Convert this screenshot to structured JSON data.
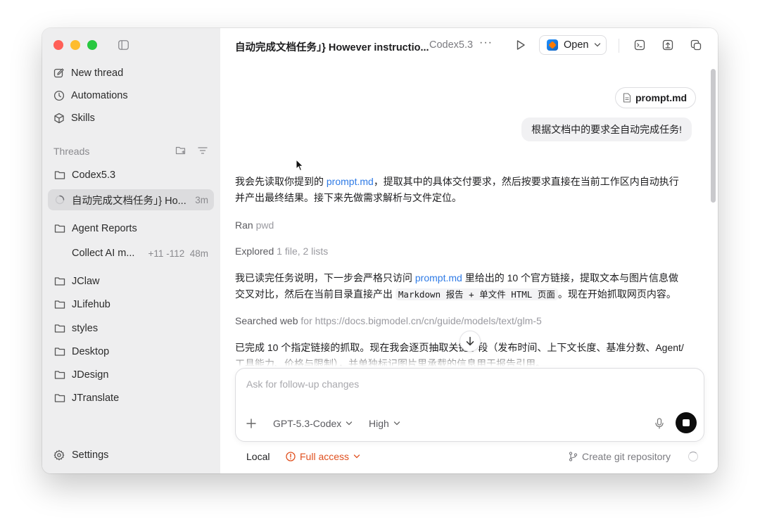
{
  "sidebar": {
    "nav": [
      {
        "label": "New thread",
        "icon": "compose-icon"
      },
      {
        "label": "Automations",
        "icon": "clock-icon"
      },
      {
        "label": "Skills",
        "icon": "cube-icon"
      }
    ],
    "threads_label": "Threads",
    "threads": [
      {
        "title": "Codex5.3",
        "meta": "",
        "type": "folder"
      },
      {
        "title": "自动完成文档任务」} Ho...",
        "meta": "3m",
        "type": "active"
      },
      {
        "title": "Agent Reports",
        "meta": "",
        "type": "folder"
      },
      {
        "title": "Collect AI m...",
        "meta_add": "+11",
        "meta_del": "-112",
        "meta": "48m",
        "type": "item"
      },
      {
        "title": "JClaw",
        "meta": "",
        "type": "folder"
      },
      {
        "title": "JLifehub",
        "meta": "",
        "type": "folder"
      },
      {
        "title": "styles",
        "meta": "",
        "type": "folder"
      },
      {
        "title": "Desktop",
        "meta": "",
        "type": "folder"
      },
      {
        "title": "JDesign",
        "meta": "",
        "type": "folder"
      },
      {
        "title": "JTranslate",
        "meta": "",
        "type": "folder"
      }
    ],
    "settings_label": "Settings"
  },
  "topbar": {
    "title": "自动完成文档任务」} However instructio...",
    "project": "Codex5.3",
    "more": "···",
    "open_label": "Open"
  },
  "conversation": {
    "attachment": "prompt.md",
    "user_message": "根据文档中的要求全自动完成任务!",
    "reply1_pre": "我会先读取你提到的 ",
    "reply1_link": "prompt.md",
    "reply1_post": "，提取其中的具体交付要求，然后按要求直接在当前工作区内自动执行并产出最终结果。接下来先做需求解析与文件定位。",
    "ran_label": "Ran",
    "ran_value": "pwd",
    "explored_label": "Explored",
    "explored_value": "1 file, 2 lists",
    "reply2_pre": "我已读完任务说明，下一步会严格只访问 ",
    "reply2_link": "prompt.md",
    "reply2_mid": " 里给出的 10 个官方链接，提取文本与图片信息做交叉对比，然后在当前目录直接产出 ",
    "reply2_code": "Markdown 报告 + 单文件 HTML 页面",
    "reply2_post": "。现在开始抓取网页内容。",
    "searched_label": "Searched web",
    "searched_value": "for https://docs.bigmodel.cn/cn/guide/models/text/glm-5",
    "reply3": "已完成 10 个指定链接的抓取。现在我会逐页抽取关键字段（发布时间、上下文长度、基准分数、Agent/工具能力、价格与限制），并单独标记图片里承载的信息用于报告引用。"
  },
  "composer": {
    "placeholder": "Ask for follow-up changes",
    "model": "GPT-5.3-Codex",
    "effort": "High"
  },
  "footer": {
    "local": "Local",
    "access": "Full access",
    "git": "Create git repository"
  }
}
